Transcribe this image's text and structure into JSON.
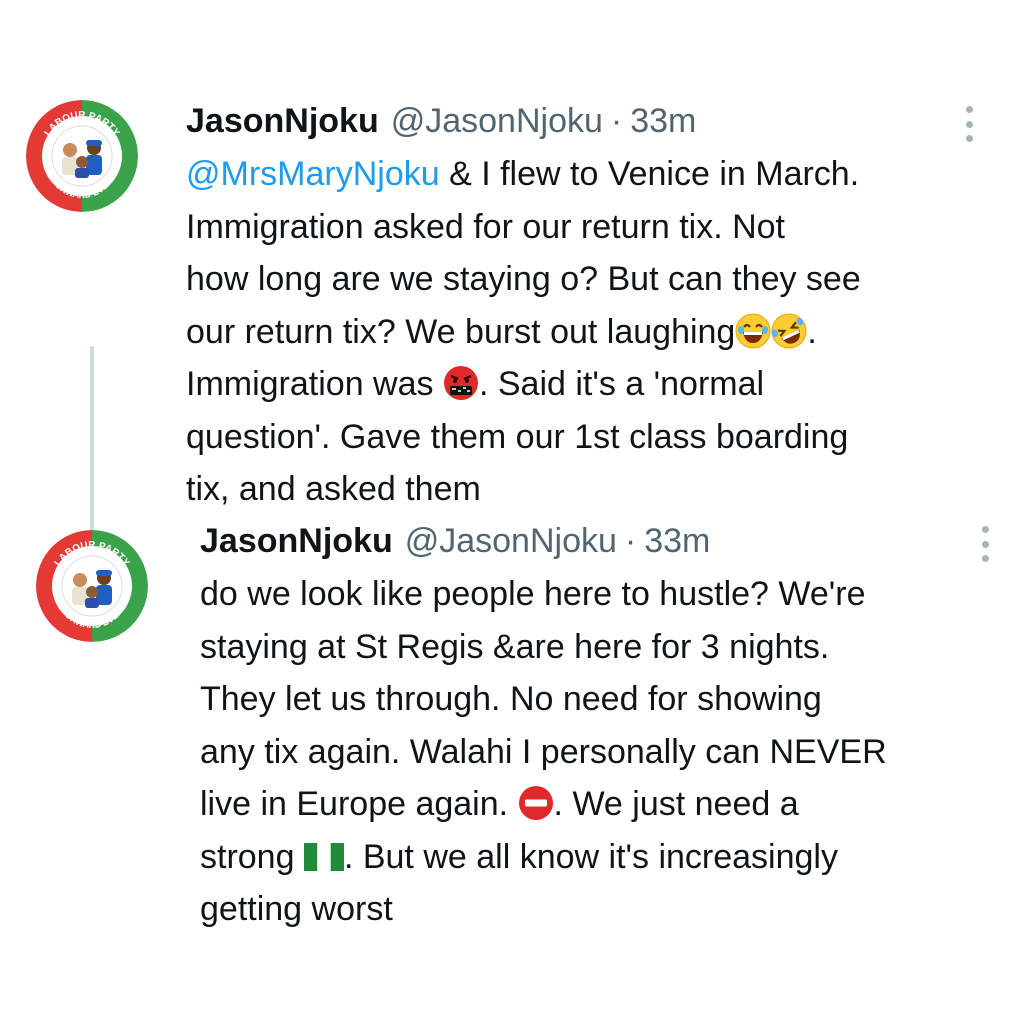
{
  "tweets": [
    {
      "display_name": "JasonNjoku",
      "handle": "@JasonNjoku",
      "separator": "·",
      "time": "33m",
      "avatar": {
        "top_text": "LABOUR PARTY",
        "bottom_text": "FORWARD EVER",
        "colors": {
          "left": "#e53935",
          "right": "#3aa34a",
          "center": "#ffffff"
        }
      },
      "lines": [
        {
          "mention": "@MrsMaryNjoku",
          "text": " & I flew to Venice in March."
        },
        {
          "text": "Immigration asked for our return tix. Not"
        },
        {
          "text": "how long are we staying o? But can they see"
        },
        {
          "text": "our return tix? We burst out laughing",
          "emojis": [
            "laughing-emoji",
            "rolling-laughing-emoji"
          ],
          "after": "."
        },
        {
          "text": "Immigration was ",
          "emojis": [
            "cursing-emoji"
          ],
          "after": ". Said it's a 'normal"
        },
        {
          "text": "question'. Gave them our 1st class boarding"
        },
        {
          "text": "tix, and asked them"
        }
      ]
    },
    {
      "display_name": "JasonNjoku",
      "handle": "@JasonNjoku",
      "separator": "·",
      "time": "33m",
      "avatar": {
        "top_text": "LABOUR PARTY",
        "bottom_text": "FORWARD EVER",
        "colors": {
          "left": "#e53935",
          "right": "#3aa34a",
          "center": "#ffffff"
        }
      },
      "lines": [
        {
          "text": "do we look like people here to hustle? We're"
        },
        {
          "text": "staying at St Regis &are here for 3 nights."
        },
        {
          "text": "They let us through. No need for showing"
        },
        {
          "text": "any tix again. Walahi I personally can NEVER"
        },
        {
          "text": "live in Europe again. ",
          "emojis": [
            "no-entry-emoji"
          ],
          "after": ". We just need a"
        },
        {
          "text": "strong ",
          "emojis": [
            "nigeria-flag-emoji"
          ],
          "after": ". But we all know it's increasingly"
        },
        {
          "text": "getting worst"
        }
      ]
    }
  ],
  "colors": {
    "text": "#0f1419",
    "secondary": "#536471",
    "link": "#1d9bf0",
    "thread_line": "#cfd9de"
  }
}
